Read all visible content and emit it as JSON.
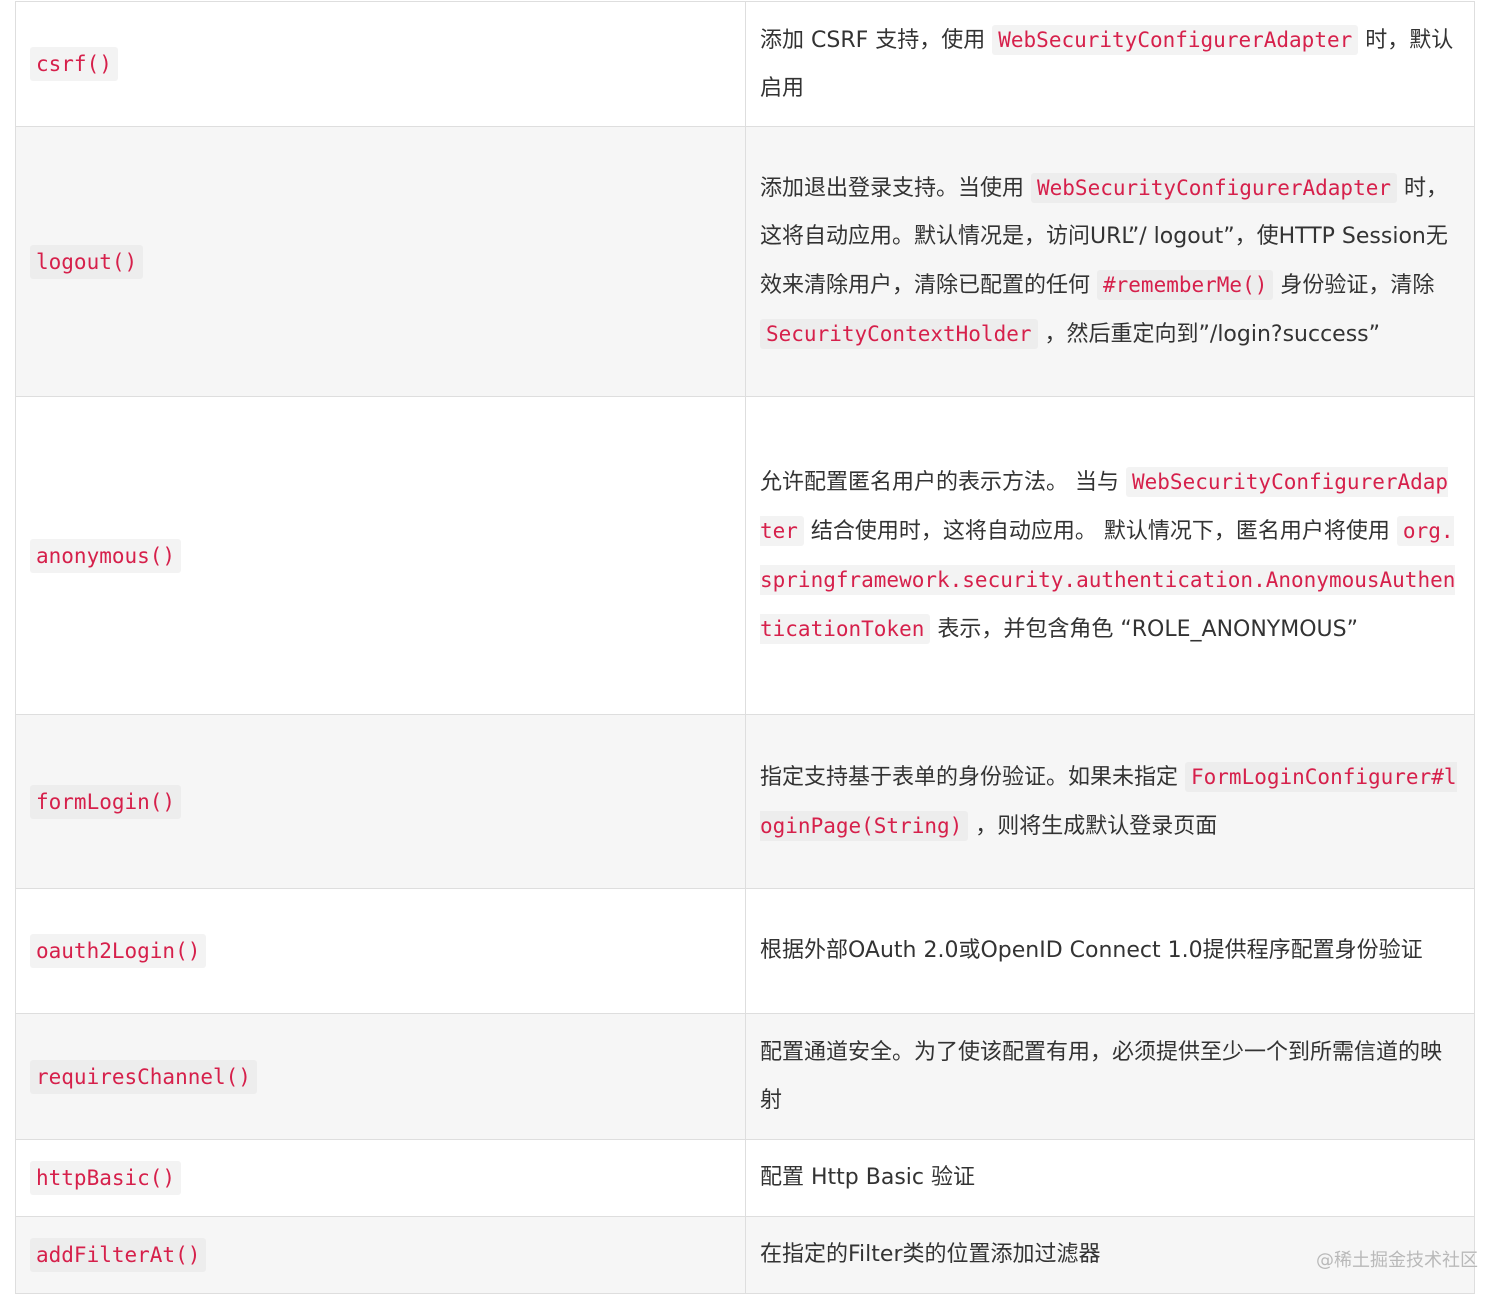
{
  "rows": [
    {
      "name": "csrf()",
      "desc": [
        {
          "t": "添加 CSRF 支持，使用 "
        },
        {
          "c": "WebSecurityConfigurerAdapter"
        },
        {
          "t": " 时，默认启用"
        }
      ]
    },
    {
      "name": "logout()",
      "desc": [
        {
          "t": "添加退出登录支持。当使用 "
        },
        {
          "c": "WebSecurityConfigurerAdapter"
        },
        {
          "t": " 时，这将自动应用。默认情况是，访问URL”/ logout”，使HTTP Session无效来清除用户，清除已配置的任何 "
        },
        {
          "c": "#rememberMe()"
        },
        {
          "t": " 身份验证，清除 "
        },
        {
          "c": "SecurityContextHolder"
        },
        {
          "t": " ，然后重定向到”/login?success”"
        }
      ]
    },
    {
      "name": "anonymous()",
      "desc": [
        {
          "t": "允许配置匿名用户的表示方法。 当与 "
        },
        {
          "c": "WebSecurityConfigurerAdapter"
        },
        {
          "t": " 结合使用时，这将自动应用。 默认情况下，匿名用户将使用 "
        },
        {
          "c": "org.springframework.security.authentication.AnonymousAuthenticationToken"
        },
        {
          "t": " 表示，并包含角色 “ROLE_ANONYMOUS”"
        }
      ]
    },
    {
      "name": "formLogin()",
      "desc": [
        {
          "t": "指定支持基于表单的身份验证。如果未指定 "
        },
        {
          "c": "FormLoginConfigurer#loginPage(String)"
        },
        {
          "t": " ，则将生成默认登录页面"
        }
      ]
    },
    {
      "name": "oauth2Login()",
      "desc": [
        {
          "t": "根据外部OAuth 2.0或OpenID Connect 1.0提供程序配置身份验证"
        }
      ]
    },
    {
      "name": "requiresChannel()",
      "desc": [
        {
          "t": "配置通道安全。为了使该配置有用，必须提供至少一个到所需信道的映射"
        }
      ]
    },
    {
      "name": "httpBasic()",
      "desc": [
        {
          "t": "配置 Http Basic 验证"
        }
      ]
    },
    {
      "name": "addFilterAt()",
      "desc": [
        {
          "t": "在指定的Filter类的位置添加过滤器"
        }
      ]
    }
  ],
  "watermark": "@稀土掘金技术社区",
  "colors": {
    "code_text": "#d6204b",
    "code_bg": "#f3f3f3",
    "border": "#dedede",
    "zebra": "#f6f6f6",
    "text": "#333333"
  }
}
